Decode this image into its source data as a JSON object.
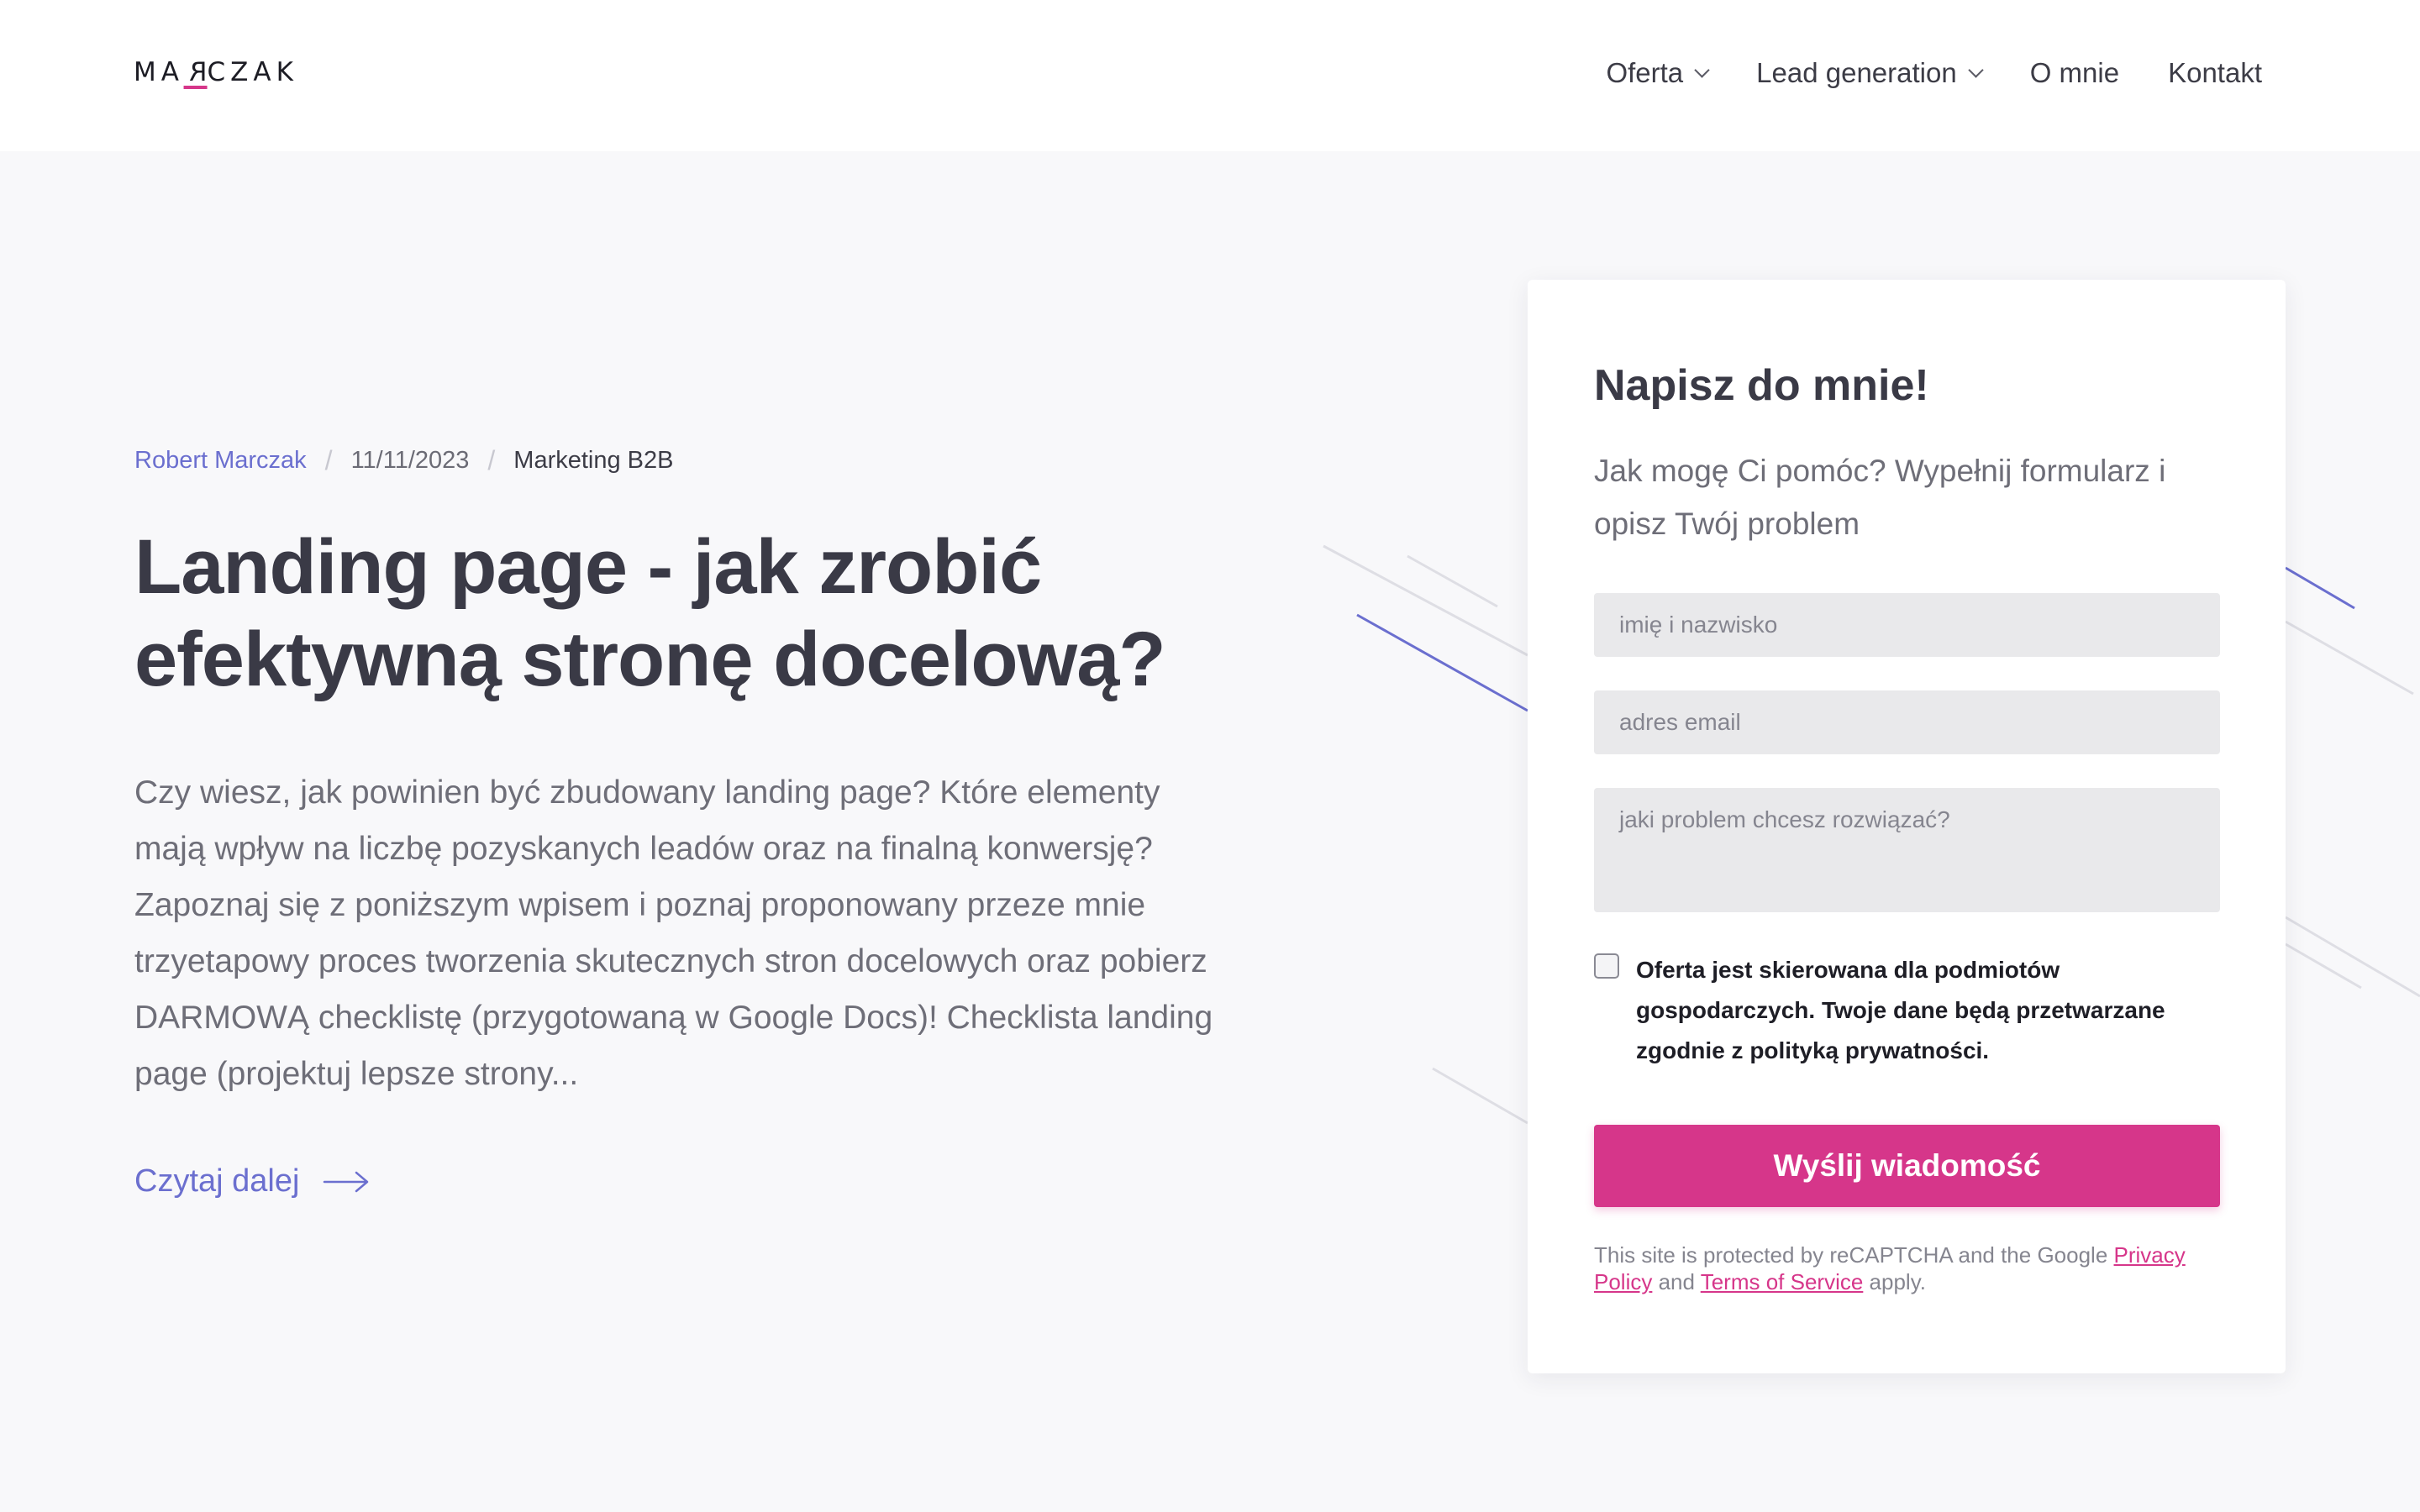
{
  "header": {
    "logo": {
      "before": "MA",
      "mirrored_letter": "R",
      "after": "CZAK",
      "accent_color": "#d6368a"
    },
    "nav": [
      {
        "label": "Oferta",
        "has_dropdown": true
      },
      {
        "label": "Lead generation",
        "has_dropdown": true
      },
      {
        "label": "O mnie",
        "has_dropdown": false
      },
      {
        "label": "Kontakt",
        "has_dropdown": false
      }
    ]
  },
  "article": {
    "author": "Robert Marczak",
    "date": "11/11/2023",
    "category": "Marketing B2B",
    "title": "Landing page - jak zrobić efektywną stronę docelową?",
    "excerpt": "Czy wiesz, jak powinien być zbudowany landing page? Które elementy mają wpływ na liczbę pozyskanych leadów oraz na finalną konwersję? Zapoznaj się z poniższym wpisem i poznaj proponowany przeze mnie trzyetapowy proces tworzenia skutecznych stron docelowych oraz pobierz DARMOWĄ checklistę (przygotowaną w Google Docs)! Checklista landing page (projektuj lepsze strony...",
    "read_more": "Czytaj dalej",
    "read_more_icon": "arrow-right-icon"
  },
  "form": {
    "title": "Napisz do mnie!",
    "subtitle": "Jak mogę Ci pomóc? Wypełnij formularz i opisz Twój problem",
    "name_placeholder": "imię i nazwisko",
    "email_placeholder": "adres email",
    "message_placeholder": "jaki problem chcesz rozwiązać?",
    "consent": "Oferta jest skierowana dla podmiotów gospodarczych. Twoje dane będą przetwarzane zgodnie z polityką prywatności.",
    "consent_checked": false,
    "submit": "Wyślij wiadomość",
    "recaptcha": {
      "text1": "This site is protected by reCAPTCHA and the Google ",
      "privacy": "Privacy Policy",
      "text2": " and ",
      "terms": "Terms of Service",
      "text3": " apply."
    }
  },
  "colors": {
    "accent": "#d6368a",
    "link": "#6b6fcf",
    "heading": "#3a3a46",
    "background": "#f8f8fa"
  }
}
